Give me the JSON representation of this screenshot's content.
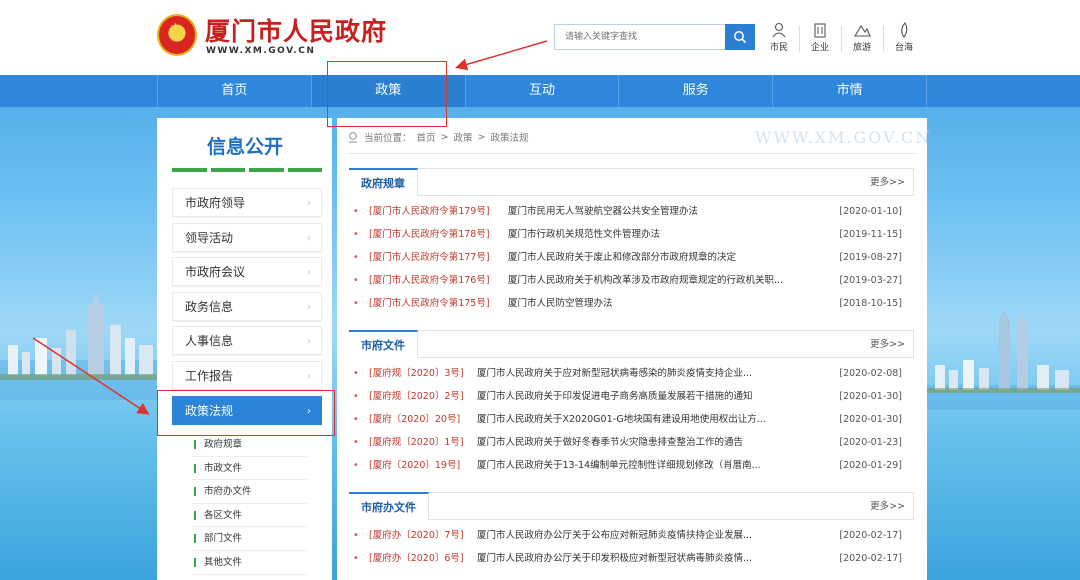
{
  "header": {
    "site_title": "厦门市人民政府",
    "site_url": "WWW.XM.GOV.CN",
    "search_placeholder": "请输入关键字查找",
    "quick_links": [
      {
        "label": "市民",
        "icon": "citizen-icon"
      },
      {
        "label": "企业",
        "icon": "building-icon"
      },
      {
        "label": "旅游",
        "icon": "travel-icon"
      },
      {
        "label": "台海",
        "icon": "leaf-icon"
      }
    ]
  },
  "nav": {
    "items": [
      "首页",
      "政策",
      "互动",
      "服务",
      "市情"
    ],
    "active": "政策"
  },
  "watermark": "WWW.XM.GOV.CN",
  "sidebar": {
    "title": "信息公开",
    "items": [
      "市政府领导",
      "领导活动",
      "市政府会议",
      "政务信息",
      "人事信息",
      "工作报告",
      "政策法规"
    ],
    "active": "政策法规",
    "subitems": [
      "政府规章",
      "市政文件",
      "市府办文件",
      "各区文件",
      "部门文件",
      "其他文件"
    ]
  },
  "breadcrumb": {
    "prefix": "当前位置：",
    "parts": [
      "首页",
      "政策",
      "政策法规"
    ],
    "separator": ">"
  },
  "sections": [
    {
      "title": "政府规章",
      "more": "更多>>",
      "rows": [
        {
          "code": "[厦门市人民政府令第179号]",
          "title": "厦门市民用无人驾驶航空器公共安全管理办法",
          "date": "[2020-01-10]"
        },
        {
          "code": "[厦门市人民政府令第178号]",
          "title": "厦门市行政机关规范性文件管理办法",
          "date": "[2019-11-15]"
        },
        {
          "code": "[厦门市人民政府令第177号]",
          "title": "厦门市人民政府关于废止和修改部分市政府规章的决定",
          "date": "[2019-08-27]"
        },
        {
          "code": "[厦门市人民政府令第176号]",
          "title": "厦门市人民政府关于机构改革涉及市政府规章规定的行政机关职...",
          "date": "[2019-03-27]"
        },
        {
          "code": "[厦门市人民政府令第175号]",
          "title": "厦门市人民防空管理办法",
          "date": "[2018-10-15]"
        }
      ]
    },
    {
      "title": "市府文件",
      "more": "更多>>",
      "rows": [
        {
          "code": "[厦府规〔2020〕3号]",
          "title": "厦门市人民政府关于应对新型冠状病毒感染的肺炎疫情支持企业...",
          "date": "[2020-02-08]"
        },
        {
          "code": "[厦府规〔2020〕2号]",
          "title": "厦门市人民政府关于印发促进电子商务高质量发展若干措施的通知",
          "date": "[2020-01-30]"
        },
        {
          "code": "[厦府〔2020〕20号]",
          "title": "厦门市人民政府关于X2020G01-G地块国有建设用地使用权出让方...",
          "date": "[2020-01-30]"
        },
        {
          "code": "[厦府规〔2020〕1号]",
          "title": "厦门市人民政府关于做好冬春季节火灾隐患排查整治工作的通告",
          "date": "[2020-01-23]"
        },
        {
          "code": "[厦府〔2020〕19号]",
          "title": "厦门市人民政府关于13-14编制单元控制性详细规划修改（肖厝南...",
          "date": "[2020-01-29]"
        }
      ]
    },
    {
      "title": "市府办文件",
      "more": "更多>>",
      "rows": [
        {
          "code": "[厦府办〔2020〕7号]",
          "title": "厦门市人民政府办公厅关于公布应对新冠肺炎疫情扶持企业发展...",
          "date": "[2020-02-17]"
        },
        {
          "code": "[厦府办〔2020〕6号]",
          "title": "厦门市人民政府办公厅关于印发积极应对新型冠状病毒肺炎疫情...",
          "date": "[2020-02-17]"
        }
      ]
    }
  ],
  "colors": {
    "brand_red": "#c9201f",
    "nav_blue": "#2e87dd",
    "active_blue": "#2c84d8",
    "accent_green": "#3ba54a",
    "annotation_red": "#e0322c"
  }
}
